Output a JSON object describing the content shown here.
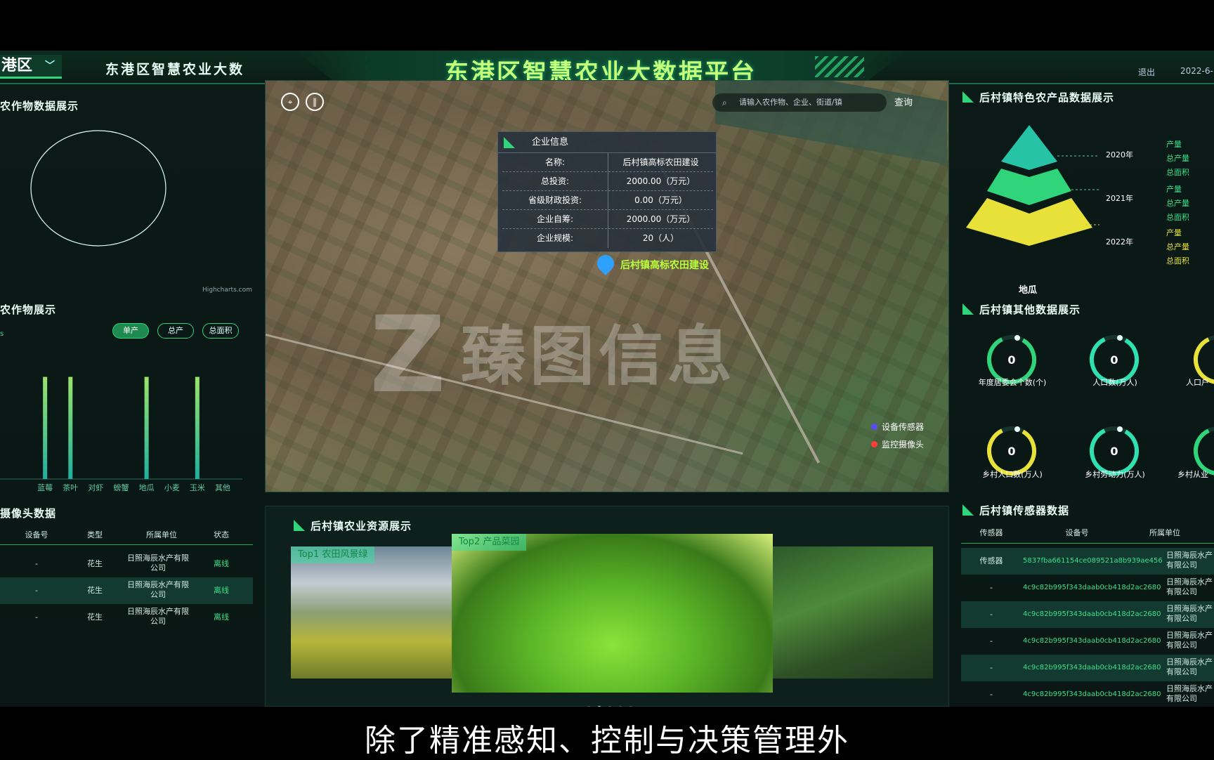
{
  "header": {
    "region_label": "港区",
    "system_name": "东港区智慧农业大数",
    "title": "东港区智慧农业大数据平台",
    "logout": "退出",
    "date": "2022-6-"
  },
  "left": {
    "crop_data_title": "农作物数据展示",
    "highcharts_credit": "Highcharts.com",
    "crop_display_title": "农作物展示",
    "axis_tick": "s",
    "toggles": [
      "单产",
      "总产",
      "总面积"
    ],
    "chart_data": {
      "type": "bar",
      "categories": [
        "",
        "蓝莓",
        "茶叶",
        "对虾",
        "螃蟹",
        "地瓜",
        "小麦",
        "玉米",
        "其他"
      ],
      "values": [
        0,
        1,
        1,
        0,
        0,
        1,
        0,
        1,
        0
      ],
      "title": "",
      "xlabel": "",
      "ylabel": "",
      "ylim": [
        0,
        1.1
      ]
    },
    "camera_title": "摄像头数据",
    "camera_headers": [
      "设备号",
      "类型",
      "所属单位",
      "状态"
    ],
    "camera_rows": [
      {
        "device": "-",
        "type": "花生",
        "unit": "日照海辰水产有限公司",
        "status": "离线"
      },
      {
        "device": "-",
        "type": "花生",
        "unit": "日照海辰水产有限公司",
        "status": "离线"
      },
      {
        "device": "-",
        "type": "花生",
        "unit": "日照海辰水产有限公司",
        "status": "离线"
      }
    ]
  },
  "map": {
    "search_placeholder": "请输入农作物、企业、街道/镇",
    "search_button": "查询",
    "popup": {
      "title": "企业信息",
      "rows": [
        {
          "k": "名称:",
          "v": "后村镇高标农田建设"
        },
        {
          "k": "总投资:",
          "v": "2000.00（万元）"
        },
        {
          "k": "省级财政投资:",
          "v": "0.00（万元）"
        },
        {
          "k": "企业自筹:",
          "v": "2000.00（万元）"
        },
        {
          "k": "企业规模:",
          "v": "20（人）"
        }
      ]
    },
    "marker_label": "后村镇高标农田建设",
    "legend": [
      {
        "label": "设备传感器",
        "color": "#5b4cff"
      },
      {
        "label": "监控摄像头",
        "color": "#ff3b3b"
      }
    ],
    "watermark": "臻图信息"
  },
  "bottom": {
    "title": "后村镇农业资源展示",
    "slides": [
      {
        "tag": "Top1 农田风景绿"
      },
      {
        "tag": "Top2 产品菜园"
      },
      {
        "tag": ""
      }
    ]
  },
  "right": {
    "special_title": "后村镇特色农产品数据展示",
    "pyramid_label": "地瓜",
    "years": [
      {
        "year": "2020年",
        "metrics": [
          "产量",
          "总产量",
          "总面积"
        ]
      },
      {
        "year": "2021年",
        "metrics": [
          "产量",
          "总产量",
          "总面积"
        ]
      },
      {
        "year": "2022年",
        "metrics": [
          "产量",
          "总产量",
          "总面积"
        ]
      }
    ],
    "other_title": "后村镇其他数据展示",
    "gauges": [
      {
        "value": "0",
        "label": "年度居委会个数(个)",
        "color": "#2fd47b"
      },
      {
        "value": "0",
        "label": "人口数(万人)",
        "color": "#2fe0b0"
      },
      {
        "value": "",
        "label": "人口户",
        "color": "#e7e13a"
      },
      {
        "value": "0",
        "label": "乡村人口数(万人)",
        "color": "#e7e13a"
      },
      {
        "value": "0",
        "label": "乡村劳动力(万人)",
        "color": "#2fe0b0"
      },
      {
        "value": "",
        "label": "乡村从业",
        "color": "#2fd47b"
      }
    ],
    "sensor_title": "后村镇传感器数据",
    "sensor_headers": [
      "传感器",
      "设备号",
      "所属单位"
    ],
    "sensor_rows": [
      {
        "sensor": "传感器",
        "device": "5837fba661154ce089521a8b939ae456",
        "unit": "日照海辰水产有限公司"
      },
      {
        "sensor": "-",
        "device": "4c9c82b995f343daab0cb418d2ac2680",
        "unit": "日照海辰水产有限公司"
      },
      {
        "sensor": "-",
        "device": "4c9c82b995f343daab0cb418d2ac2680",
        "unit": "日照海辰水产有限公司"
      },
      {
        "sensor": "-",
        "device": "4c9c82b995f343daab0cb418d2ac2680",
        "unit": "日照海辰水产有限公司"
      },
      {
        "sensor": "-",
        "device": "4c9c82b995f343daab0cb418d2ac2680",
        "unit": "日照海辰水产有限公司"
      },
      {
        "sensor": "-",
        "device": "4c9c82b995f343daab0cb418d2ac2680",
        "unit": "日照海辰水产有限公司"
      }
    ]
  },
  "subtitle": "除了精准感知、控制与决策管理外"
}
